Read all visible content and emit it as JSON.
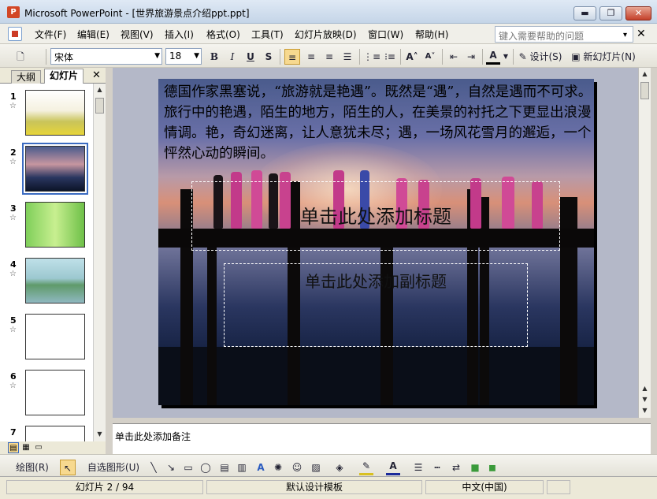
{
  "window": {
    "app_badge": "P",
    "title": "Microsoft PowerPoint - [世界旅游景点介绍ppt.ppt]",
    "minimize": "▬",
    "maximize": "❐",
    "close": "✕"
  },
  "menu": {
    "items": [
      "文件(F)",
      "编辑(E)",
      "视图(V)",
      "插入(I)",
      "格式(O)",
      "工具(T)",
      "幻灯片放映(D)",
      "窗口(W)",
      "帮助(H)"
    ],
    "help_placeholder": "键入需要帮助的问题",
    "help_arrow": "▾",
    "doc_close": "✕"
  },
  "toolbar": {
    "font": "宋体",
    "font_size": "18",
    "bold": "B",
    "italic": "I",
    "underline": "U",
    "shadow": "S",
    "align_left": "≡",
    "align_center": "≡",
    "align_right": "≡",
    "distribute": "☰",
    "numbering": "⋮≡",
    "bullets": "⁝≡",
    "grow_font": "A˄",
    "shrink_font": "A˅",
    "decrease_indent": "⇤",
    "increase_indent": "⇥",
    "font_color": "A",
    "design": "设计(S)",
    "new_slide": "新幻灯片(N)"
  },
  "left_pane": {
    "tabs": [
      "大纲",
      "幻灯片"
    ],
    "close": "✕",
    "thumbnails": [
      {
        "num": "1",
        "star": "☆"
      },
      {
        "num": "2",
        "star": "☆"
      },
      {
        "num": "3",
        "star": "☆"
      },
      {
        "num": "4",
        "star": "☆"
      },
      {
        "num": "5",
        "star": "☆"
      },
      {
        "num": "6",
        "star": "☆"
      },
      {
        "num": "7",
        "star": ""
      }
    ]
  },
  "slide": {
    "body_text": "德国作家黑塞说，“旅游就是艳遇”。既然是“遇”，自然是遇而不可求。旅行中的艳遇，陌生的地方，陌生的人，在美景的衬托之下更显出浪漫情调。艳，奇幻迷离，让人意犹未尽；遇，一场风花雪月的邂逅，一个怦然心动的瞬间。",
    "title_placeholder": "单击此处添加标题",
    "subtitle_placeholder": "单击此处添加副标题"
  },
  "notes": {
    "placeholder": "单击此处添加备注"
  },
  "drawing_bar": {
    "draw": "绘图(R)",
    "autoshapes": "自选图形(U)"
  },
  "status": {
    "slide": "幻灯片 2 / 94",
    "template": "默认设计模板",
    "language": "中文(中国)"
  },
  "colors": {
    "accent": "#3b6bc1",
    "selection": "#f7d98f"
  }
}
